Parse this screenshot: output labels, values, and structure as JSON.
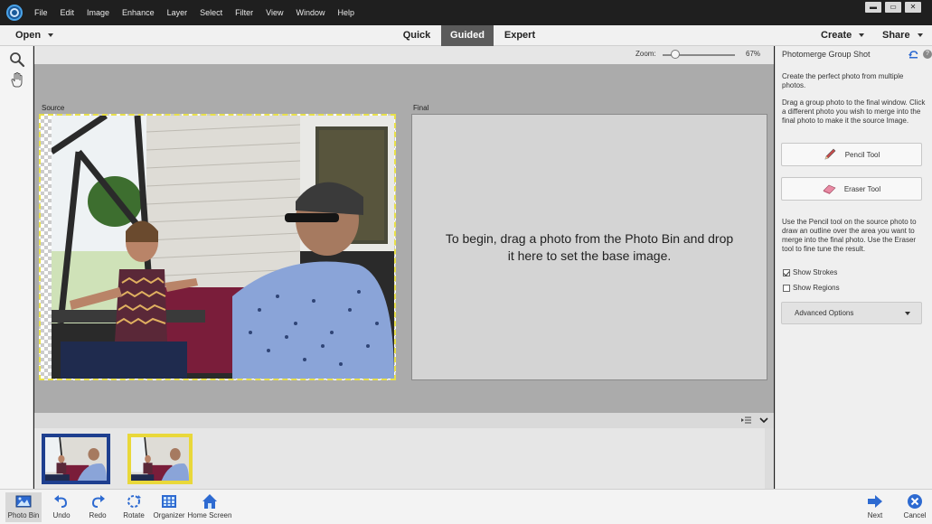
{
  "menubar": {
    "items": [
      "File",
      "Edit",
      "Image",
      "Enhance",
      "Layer",
      "Select",
      "Filter",
      "View",
      "Window",
      "Help"
    ],
    "window_controls": {
      "minimize": "▬",
      "restore": "▭",
      "close": "✕"
    }
  },
  "modebar": {
    "open_label": "Open",
    "tabs": [
      {
        "label": "Quick",
        "active": false
      },
      {
        "label": "Guided",
        "active": true
      },
      {
        "label": "Expert",
        "active": false
      }
    ],
    "create_label": "Create",
    "share_label": "Share"
  },
  "left_tools": [
    "zoom-icon",
    "hand-icon"
  ],
  "workspace": {
    "zoom_label": "Zoom:",
    "zoom_value": "67%",
    "zoom_fraction": 0.18,
    "source_label": "Source",
    "final_label": "Final",
    "final_instructions": "To begin, drag a photo from the Photo Bin and drop it here to set the base image."
  },
  "right_panel": {
    "title": "Photomerge Group Shot",
    "intro": "Create the perfect photo from multiple photos.",
    "drag_instructions": "Drag a group photo to the final window. Click a different photo you wish to merge into the final photo to make it the source Image.",
    "pencil_tool_label": "Pencil Tool",
    "eraser_tool_label": "Eraser Tool",
    "pencil_instructions": "Use the Pencil tool on the source photo to draw an outline over the area you want to merge into the final photo. Use the Eraser tool to fine tune the result.",
    "show_strokes_label": "Show Strokes",
    "show_strokes_checked": true,
    "show_regions_label": "Show Regions",
    "show_regions_checked": false,
    "advanced_options_label": "Advanced Options"
  },
  "taskbar": {
    "photo_bin": "Photo Bin",
    "undo": "Undo",
    "redo": "Redo",
    "rotate": "Rotate",
    "organizer": "Organizer",
    "home_screen": "Home Screen",
    "next": "Next",
    "cancel": "Cancel"
  },
  "colors": {
    "accent_blue": "#1e3f8f",
    "source_border": "#e8e04a",
    "guided_tab": "#5b5b5b"
  }
}
